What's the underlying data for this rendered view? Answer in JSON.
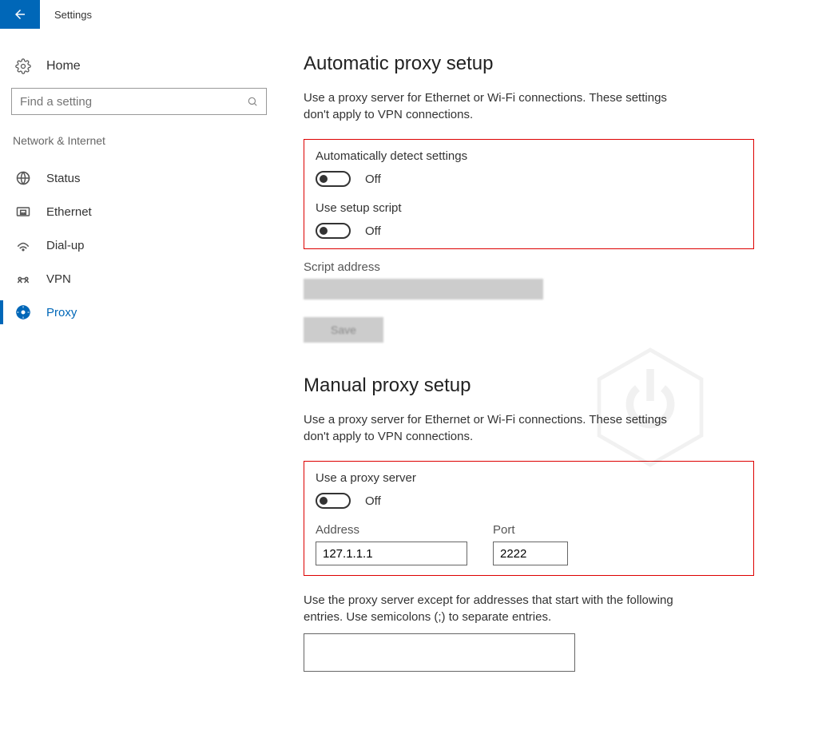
{
  "header": {
    "title": "Settings"
  },
  "sidebar": {
    "home": "Home",
    "search_placeholder": "Find a setting",
    "category": "Network & Internet",
    "items": [
      {
        "label": "Status",
        "icon": "status"
      },
      {
        "label": "Ethernet",
        "icon": "ethernet"
      },
      {
        "label": "Dial-up",
        "icon": "dialup"
      },
      {
        "label": "VPN",
        "icon": "vpn"
      },
      {
        "label": "Proxy",
        "icon": "proxy",
        "active": true
      }
    ]
  },
  "content": {
    "auto": {
      "title": "Automatic proxy setup",
      "desc": "Use a proxy server for Ethernet or Wi-Fi connections. These settings don't apply to VPN connections.",
      "detect_label": "Automatically detect settings",
      "detect_state": "Off",
      "script_label": "Use setup script",
      "script_state": "Off",
      "script_addr_label": "Script address",
      "save": "Save"
    },
    "manual": {
      "title": "Manual proxy setup",
      "desc": "Use a proxy server for Ethernet or Wi-Fi connections. These settings don't apply to VPN connections.",
      "use_label": "Use a proxy server",
      "use_state": "Off",
      "address_label": "Address",
      "address_value": "127.1.1.1",
      "port_label": "Port",
      "port_value": "2222",
      "except_text": "Use the proxy server except for addresses that start with the following entries. Use semicolons (;) to separate entries."
    }
  }
}
